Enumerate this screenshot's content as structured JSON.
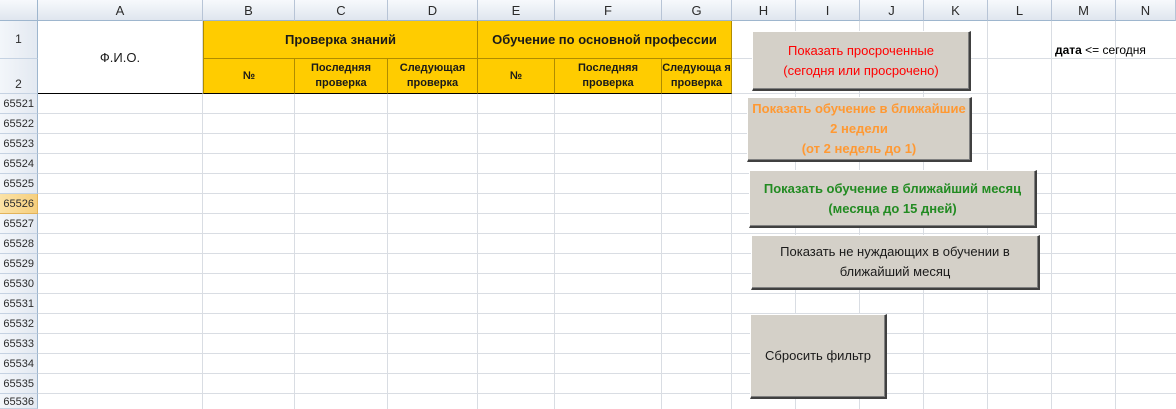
{
  "columns": [
    "A",
    "B",
    "C",
    "D",
    "E",
    "F",
    "G",
    "H",
    "I",
    "J",
    "K",
    "L",
    "M",
    "N"
  ],
  "header_rows": [
    "1",
    "2"
  ],
  "rows": [
    "65521",
    "65522",
    "65523",
    "65524",
    "65525",
    "65526",
    "65527",
    "65528",
    "65529",
    "65530",
    "65531",
    "65532",
    "65533",
    "65534",
    "65535",
    "65536"
  ],
  "selected_row": "65526",
  "table_header": {
    "fio": "Ф.И.О.",
    "knowledge_check": "Проверка знаний",
    "training_main": "Обучение по основной профессии",
    "no_1": "№",
    "last_check_1": "Последняя проверка",
    "next_check_1": "Следующая проверка",
    "no_2": "№",
    "last_check_2": "Последняя проверка",
    "next_check_2": "Следующа я проверка"
  },
  "buttons": {
    "overdue": "Показать просроченные\n(сегодня или просрочено)",
    "two_weeks": "Показать обучение в ближайшие\n2 недели\n(от 2 недель до 1)",
    "month": "Показать обучение в ближайший месяц\n(месяца до 15 дней)",
    "not_needed": "Показать не нуждающих в обучении в\nближайший месяц",
    "reset": "Сбросить фильтр"
  },
  "note": {
    "bold": "дата",
    "rest": " <= сегодня"
  },
  "colors": {
    "header_fill": "#ffcc00",
    "overdue_text": "#ff0000",
    "two_weeks_text": "#ff9933",
    "month_text": "#228b22",
    "selected_row_header": "#f6cf7e"
  }
}
